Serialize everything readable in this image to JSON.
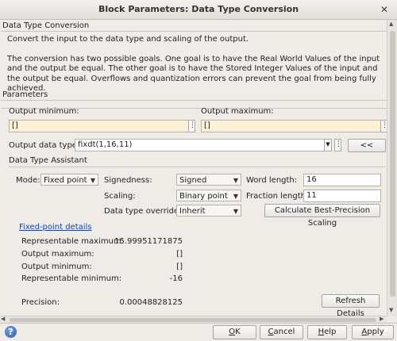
{
  "window": {
    "title": "Block Parameters: Data Type Conversion",
    "close_glyph": "✕"
  },
  "description": {
    "group_title": "Data Type Conversion",
    "line1": "Convert the input to the data type and scaling of the output.",
    "line2": "The conversion has two possible goals. One goal is to have the Real World Values of the input and the output be equal.  The other goal is to have the Stored Integer Values of the input and the output be equal. Overflows and quantization errors can prevent the goal from being fully achieved."
  },
  "parameters": {
    "group_title": "Parameters",
    "output_minimum": {
      "label": "Output minimum:",
      "value": "[]"
    },
    "output_maximum": {
      "label": "Output maximum:",
      "value": "[]"
    },
    "output_data_type": {
      "label": "Output data type:",
      "value": "fixdt(1,16,11)"
    },
    "assistant_toggle_label": "<<",
    "ellipsis": "⋮"
  },
  "assistant": {
    "group_title": "Data Type Assistant",
    "mode": {
      "label": "Mode:",
      "value": "Fixed point"
    },
    "signedness": {
      "label": "Signedness:",
      "value": "Signed"
    },
    "word_length": {
      "label": "Word length:",
      "value": "16"
    },
    "scaling": {
      "label": "Scaling:",
      "value": "Binary point"
    },
    "fraction_length": {
      "label": "Fraction length:",
      "value": "11"
    },
    "override": {
      "label": "Data type override:",
      "value": "Inherit"
    },
    "calc_button": "Calculate Best-Precision Scaling",
    "details_link": "Fixed-point details",
    "details": [
      {
        "label": "Representable maximum:",
        "value": "15.99951171875"
      },
      {
        "label": "Output maximum:",
        "value": "[]"
      },
      {
        "label": "Output minimum:",
        "value": "[]"
      },
      {
        "label": "Representable minimum:",
        "value": "-16"
      }
    ],
    "precision": {
      "label": "Precision:",
      "value": "0.00048828125"
    },
    "refresh_button": "Refresh Details"
  },
  "footer": {
    "help_icon_glyph": "?",
    "ok": {
      "mnemonic": "O",
      "rest": "K"
    },
    "cancel": {
      "mnemonic": "C",
      "rest": "ancel"
    },
    "help": {
      "mnemonic": "H",
      "rest": "elp"
    },
    "apply": {
      "mnemonic": "A",
      "rest": "pply"
    }
  },
  "scroll": {
    "up": "▲",
    "down": "▼",
    "left": "◀",
    "right": "▶"
  }
}
